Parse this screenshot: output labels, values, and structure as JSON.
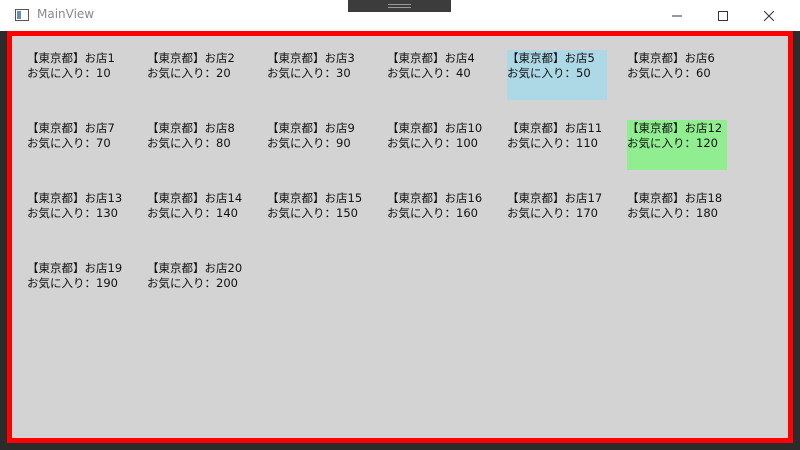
{
  "window": {
    "title": "MainView",
    "border_color": "#ff0000",
    "content_background": "#d3d3d3"
  },
  "caption_buttons": {
    "minimize_icon": "minimize-icon",
    "maximize_icon": "maximize-icon",
    "close_icon": "close-icon"
  },
  "shops": [
    {
      "name": "【東京都】お店1",
      "favorites": "お気に入り：10",
      "highlight": ""
    },
    {
      "name": "【東京都】お店2",
      "favorites": "お気に入り：20",
      "highlight": ""
    },
    {
      "name": "【東京都】お店3",
      "favorites": "お気に入り：30",
      "highlight": ""
    },
    {
      "name": "【東京都】お店4",
      "favorites": "お気に入り：40",
      "highlight": ""
    },
    {
      "name": "【東京都】お店5",
      "favorites": "お気に入り：50",
      "highlight": "#add8e6"
    },
    {
      "name": "【東京都】お店6",
      "favorites": "お気に入り：60",
      "highlight": ""
    },
    {
      "name": "【東京都】お店7",
      "favorites": "お気に入り：70",
      "highlight": ""
    },
    {
      "name": "【東京都】お店8",
      "favorites": "お気に入り：80",
      "highlight": ""
    },
    {
      "name": "【東京都】お店9",
      "favorites": "お気に入り：90",
      "highlight": ""
    },
    {
      "name": "【東京都】お店10",
      "favorites": "お気に入り：100",
      "highlight": ""
    },
    {
      "name": "【東京都】お店11",
      "favorites": "お気に入り：110",
      "highlight": ""
    },
    {
      "name": "【東京都】お店12",
      "favorites": "お気に入り：120",
      "highlight": "#90ee90"
    },
    {
      "name": "【東京都】お店13",
      "favorites": "お気に入り：130",
      "highlight": ""
    },
    {
      "name": "【東京都】お店14",
      "favorites": "お気に入り：140",
      "highlight": ""
    },
    {
      "name": "【東京都】お店15",
      "favorites": "お気に入り：150",
      "highlight": ""
    },
    {
      "name": "【東京都】お店16",
      "favorites": "お気に入り：160",
      "highlight": ""
    },
    {
      "name": "【東京都】お店17",
      "favorites": "お気に入り：170",
      "highlight": ""
    },
    {
      "name": "【東京都】お店18",
      "favorites": "お気に入り：180",
      "highlight": ""
    },
    {
      "name": "【東京都】お店19",
      "favorites": "お気に入り：190",
      "highlight": ""
    },
    {
      "name": "【東京都】お店20",
      "favorites": "お気に入り：200",
      "highlight": ""
    }
  ]
}
